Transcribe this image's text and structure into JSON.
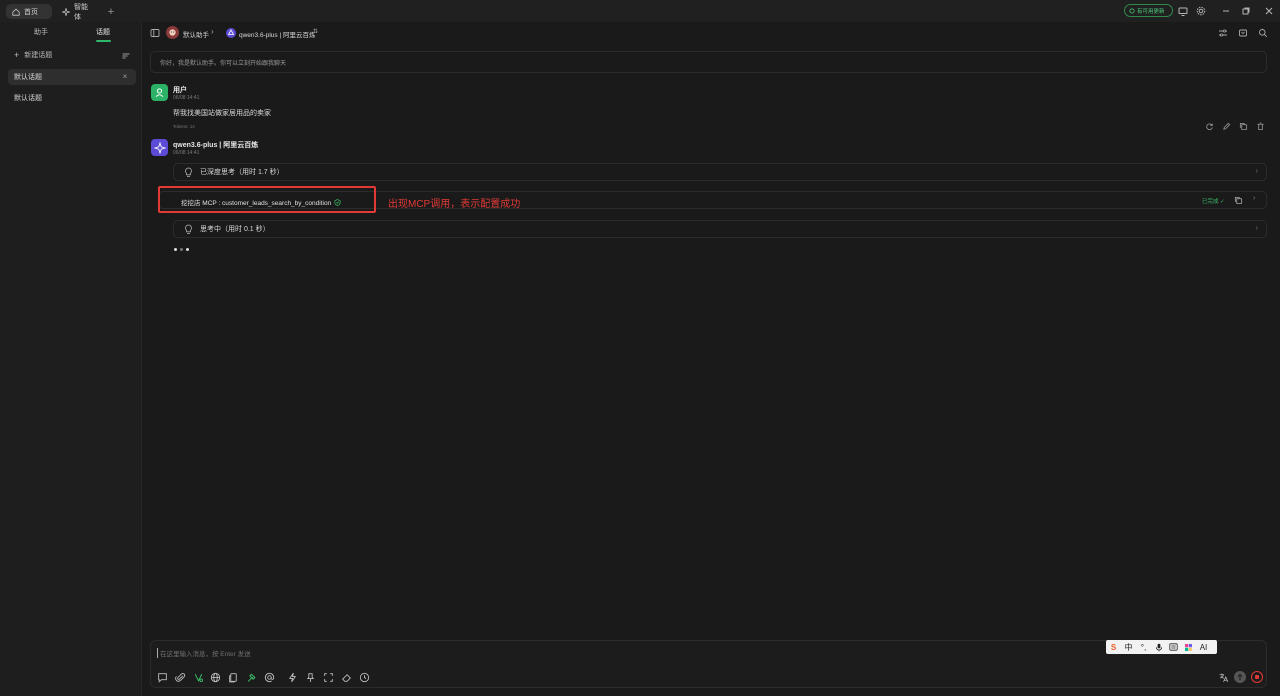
{
  "topbar": {
    "tabs": [
      {
        "label": "首页",
        "icon": "home-icon"
      },
      {
        "label": "智能体",
        "icon": "sparkle-icon"
      }
    ],
    "update_label": "有可用更新"
  },
  "sidebar": {
    "tabs": [
      "助手",
      "话题"
    ],
    "active_tab": "话题",
    "new_topic_label": "新建话题",
    "topics": [
      {
        "label": "默认话题",
        "active": true
      },
      {
        "label": "默认话题",
        "active": false
      }
    ]
  },
  "header": {
    "assistant_name": "默认助手",
    "model_name": "qwen3.6-plus | 阿里云百炼"
  },
  "prompt": {
    "text": "你好，我是默认助手。你可以立刻开始跟我聊天"
  },
  "messages": {
    "user": {
      "name": "用户",
      "time": "06/08 14:41",
      "text": "帮我找美国站做家居用品的卖家",
      "tokens": "Tokens: 14"
    },
    "assistant": {
      "name": "qwen3.6-plus | 阿里云百炼",
      "time": "06/08 14:41",
      "thinking_1": "已深度思考（用时 1.7 秒）",
      "mcp_label": "挖挖店 MCP : customer_leads_search_by_condition",
      "mcp_status": "已完成",
      "thinking_2": "思考中（用时 0.1 秒）"
    }
  },
  "annotation": {
    "text": "出现MCP调用，表示配置成功",
    "color": "#e23a36"
  },
  "input": {
    "placeholder": "在这里输入消息，按 Enter 发送"
  },
  "ime": {
    "items": [
      "S",
      "中",
      "°,",
      "mic-icon",
      "keyboard-icon",
      "skin-icon",
      "AI"
    ]
  },
  "colors": {
    "accent": "#2fb86a",
    "background": "#1a1a1a",
    "bot_avatar": "#5b4bd6"
  }
}
